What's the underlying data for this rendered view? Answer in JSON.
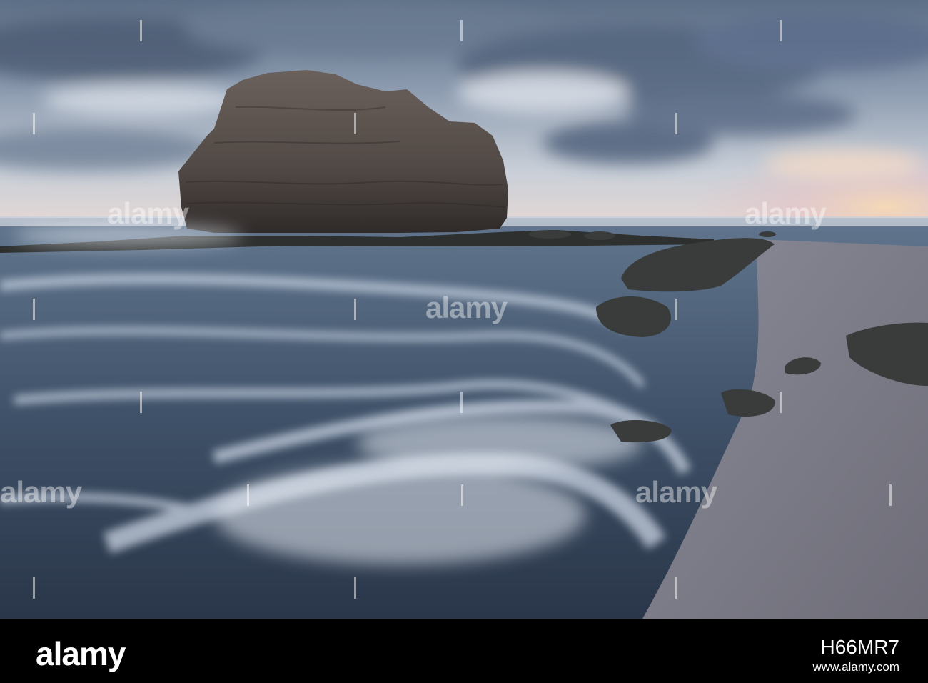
{
  "watermark": {
    "text": "alamy"
  },
  "footer": {
    "logo": "alamy",
    "stock_id": "H66MR7",
    "site": "www.alamy.com"
  }
}
